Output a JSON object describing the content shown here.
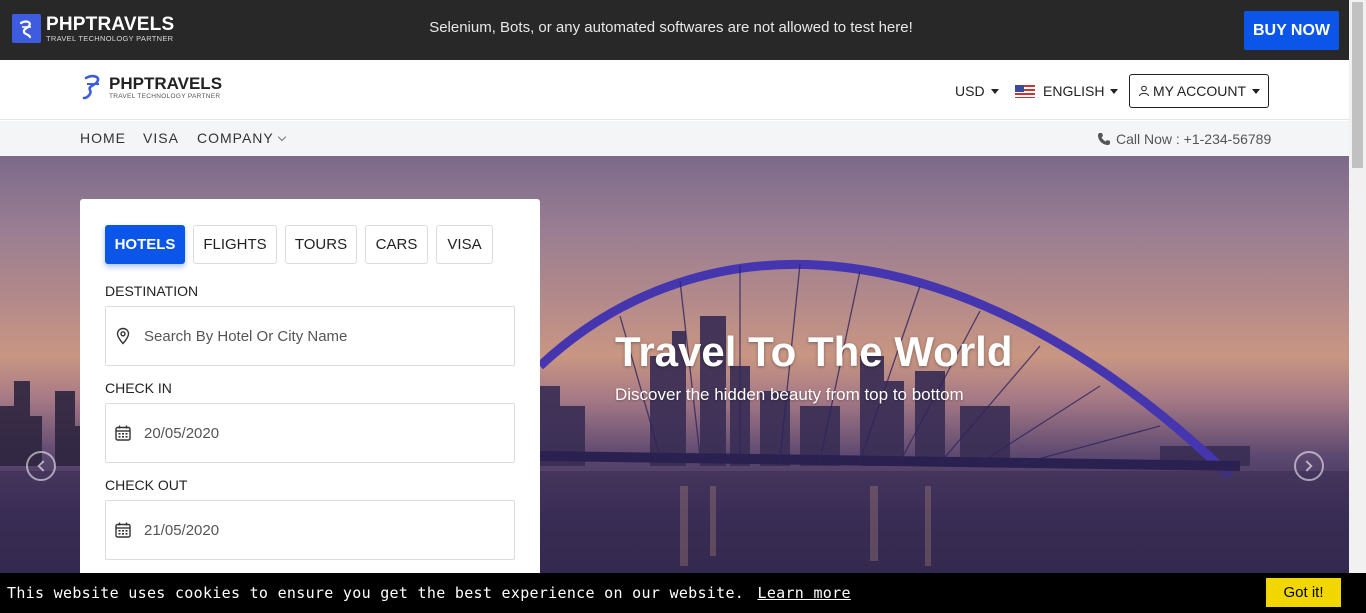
{
  "topbar": {
    "brand_name": "PHPTRAVELS",
    "brand_tagline": "TRAVEL TECHNOLOGY PARTNER",
    "notice": "Selenium, Bots, or any automated softwares are not allowed to test here!",
    "buy_label": "BUY NOW"
  },
  "header": {
    "brand_name": "PHPTRAVELS",
    "brand_tagline": "TRAVEL TECHNOLOGY PARTNER",
    "currency": "USD",
    "language": "ENGLISH",
    "account_label": "MY ACCOUNT"
  },
  "nav": {
    "items": [
      {
        "label": "HOME"
      },
      {
        "label": "VISA"
      },
      {
        "label": "COMPANY"
      }
    ],
    "call_label": "Call Now : +1-234-56789"
  },
  "hero": {
    "title": "Travel To The World",
    "subtitle": "Discover the hidden beauty from top to bottom"
  },
  "search": {
    "tabs": [
      {
        "label": "HOTELS",
        "active": true
      },
      {
        "label": "FLIGHTS",
        "active": false
      },
      {
        "label": "TOURS",
        "active": false
      },
      {
        "label": "CARS",
        "active": false
      },
      {
        "label": "VISA",
        "active": false
      }
    ],
    "destination_label": "DESTINATION",
    "destination_placeholder": "Search By Hotel Or City Name",
    "checkin_label": "CHECK IN",
    "checkin_value": "20/05/2020",
    "checkout_label": "CHECK OUT",
    "checkout_value": "21/05/2020"
  },
  "cookie": {
    "message": "This website uses cookies to ensure you get the best experience on our website.",
    "learn_more": "Learn more",
    "accept_label": "Got it!"
  },
  "colors": {
    "accent": "#0b56e8",
    "topbar_bg": "#282828",
    "cookie_button": "#f1d600"
  }
}
